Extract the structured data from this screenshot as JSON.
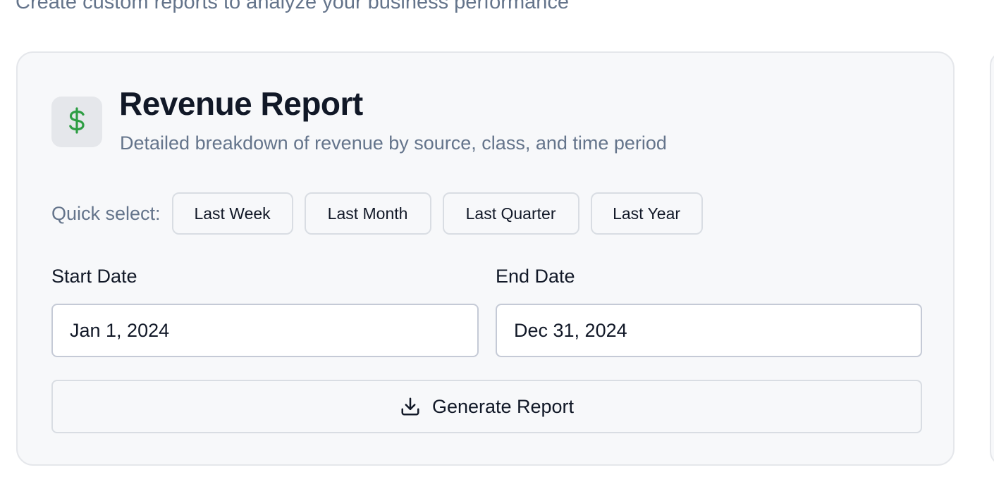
{
  "page": {
    "subtitle": "Create custom reports to analyze your business performance"
  },
  "report_card": {
    "icon": "dollar-sign-icon",
    "icon_color": "#2e9e44",
    "title": "Revenue Report",
    "description": "Detailed breakdown of revenue by source, class, and time period",
    "quick_select": {
      "label": "Quick select:",
      "options": [
        "Last Week",
        "Last Month",
        "Last Quarter",
        "Last Year"
      ]
    },
    "start_date": {
      "label": "Start Date",
      "value": "Jan 1, 2024"
    },
    "end_date": {
      "label": "End Date",
      "value": "Dec 31, 2024"
    },
    "generate_button": {
      "label": "Generate Report",
      "icon": "download-icon"
    }
  }
}
